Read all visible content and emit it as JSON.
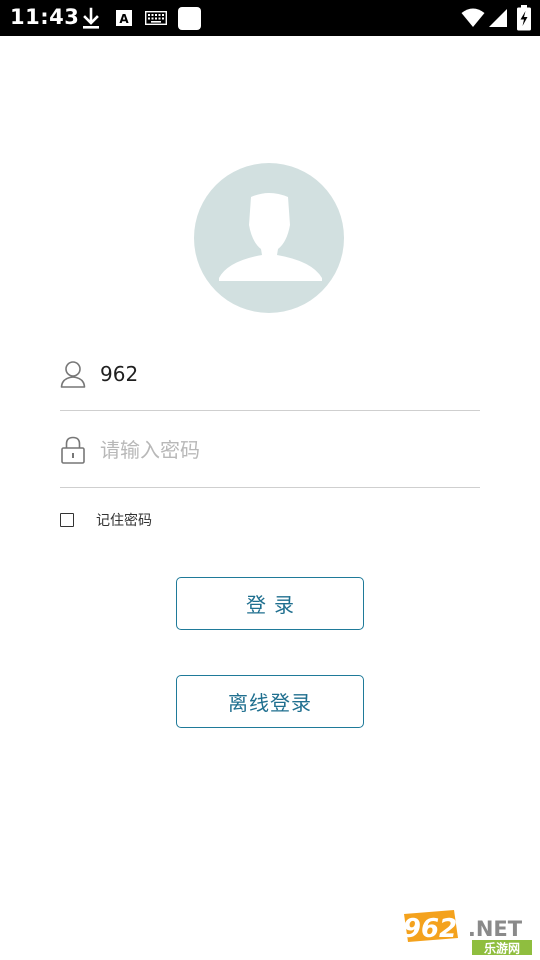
{
  "status_bar": {
    "time": "11:43",
    "left_icons": [
      "download-icon",
      "font-a-icon",
      "keyboard-icon",
      "app-square-icon"
    ],
    "right_icons": [
      "wifi-icon",
      "cellular-signal-icon",
      "battery-charging-icon"
    ],
    "font_icon_letter": "A"
  },
  "login": {
    "username_value": "962",
    "password_placeholder": "请输入密码",
    "remember_label": "记住密码",
    "remember_checked": false,
    "login_button": "登录",
    "offline_button": "离线登录"
  },
  "watermark": {
    "brand": "962",
    "suffix": ".NET",
    "subtitle": "乐游网"
  },
  "colors": {
    "status_bar_bg": "#000000",
    "avatar_bg": "#d2e0e0",
    "button_border": "#1f7a99",
    "button_text": "#1f6f8f",
    "divider": "#cfcfcf",
    "placeholder": "#b8b8b8"
  }
}
